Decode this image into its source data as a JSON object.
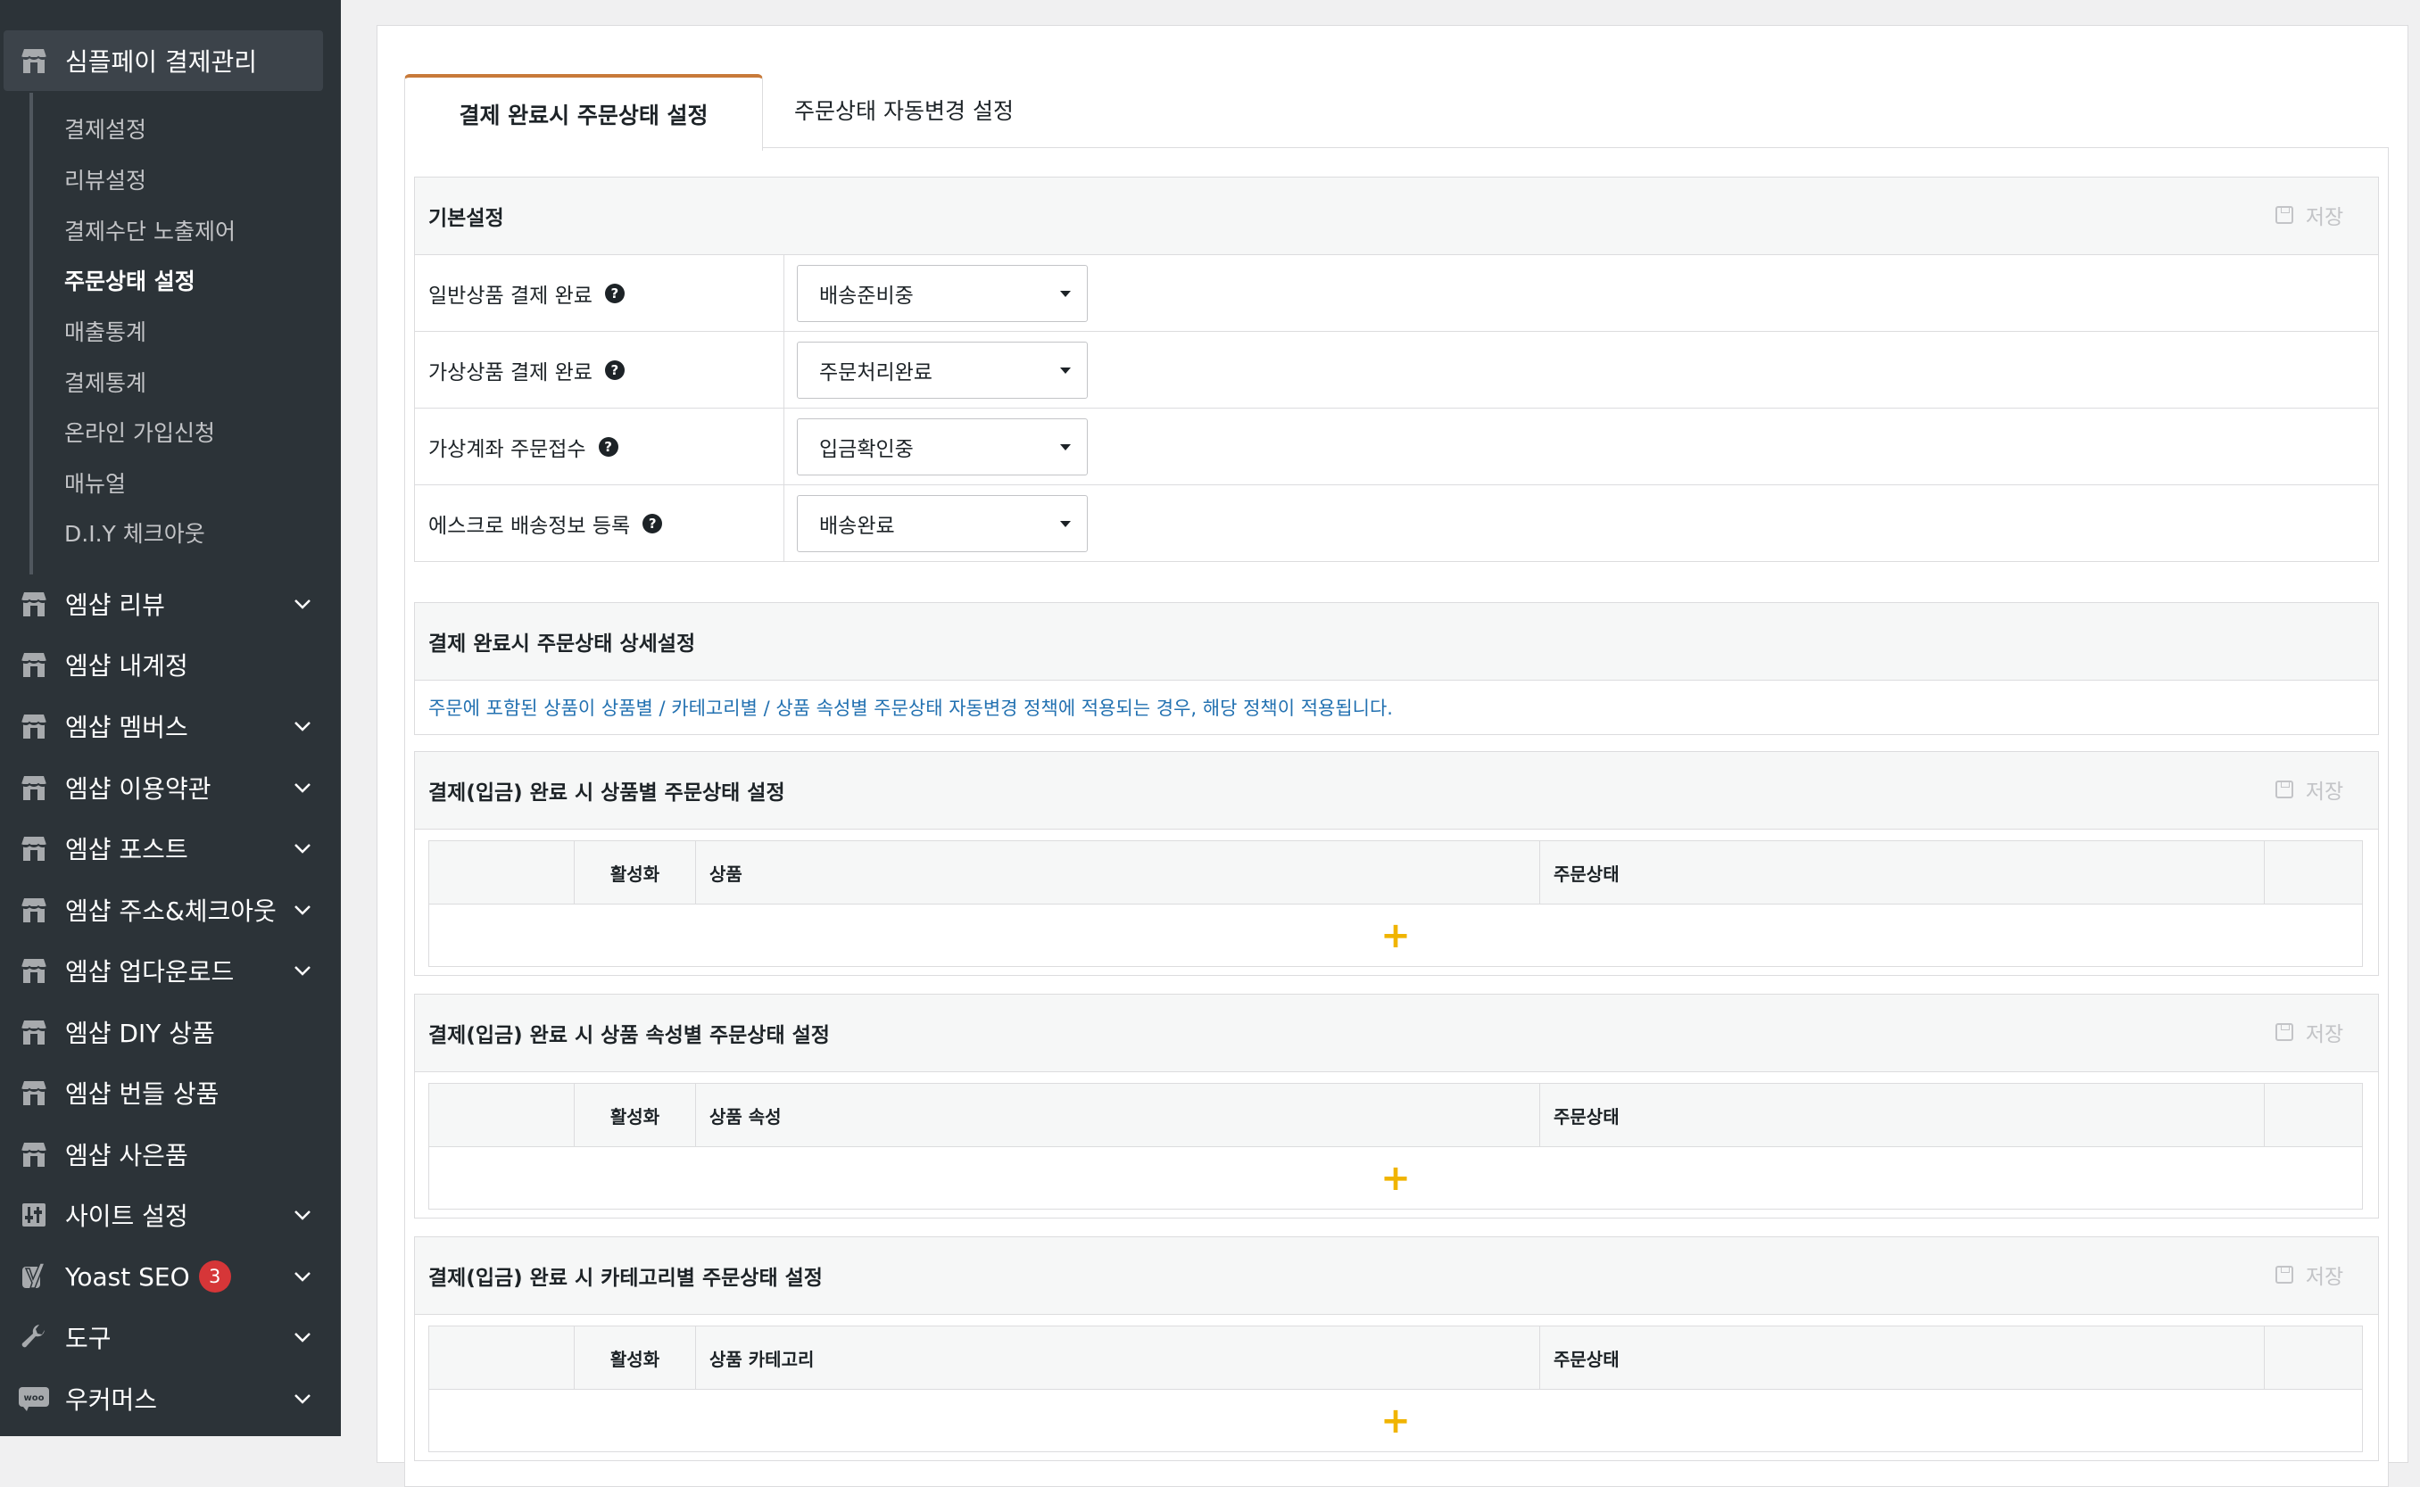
{
  "sidebar": {
    "top_menu": {
      "label": "심플페이 결제관리",
      "icon": "store-icon"
    },
    "submenu": [
      {
        "label": "결제설정"
      },
      {
        "label": "리뷰설정"
      },
      {
        "label": "결제수단 노출제어"
      },
      {
        "label": "주문상태 설정",
        "current": true
      },
      {
        "label": "매출통계"
      },
      {
        "label": "결제통계"
      },
      {
        "label": "온라인 가입신청"
      },
      {
        "label": "매뉴얼"
      },
      {
        "label": "D.I.Y 체크아웃"
      }
    ],
    "menus": [
      {
        "label": "엠샵 리뷰",
        "icon": "store-icon",
        "has_submenu": true
      },
      {
        "label": "엠샵 내계정",
        "icon": "store-icon",
        "has_submenu": false
      },
      {
        "label": "엠샵 멤버스",
        "icon": "store-icon",
        "has_submenu": true
      },
      {
        "label": "엠샵 이용약관",
        "icon": "store-icon",
        "has_submenu": true
      },
      {
        "label": "엠샵 포스트",
        "icon": "store-icon",
        "has_submenu": true
      },
      {
        "label": "엠샵 주소&체크아웃",
        "icon": "store-icon",
        "has_submenu": true
      },
      {
        "label": "엠샵 업다운로드",
        "icon": "store-icon",
        "has_submenu": true
      },
      {
        "label": "엠샵 DIY 상품",
        "icon": "store-icon",
        "has_submenu": false
      },
      {
        "label": "엠샵 번들 상품",
        "icon": "store-icon",
        "has_submenu": false
      },
      {
        "label": "엠샵 사은품",
        "icon": "store-icon",
        "has_submenu": false
      },
      {
        "label": "사이트 설정",
        "icon": "sliders-icon",
        "has_submenu": true
      },
      {
        "label": "Yoast SEO",
        "icon": "yoast-icon",
        "has_submenu": true,
        "badge": "3"
      },
      {
        "label": "도구",
        "icon": "wrench-icon",
        "has_submenu": true
      },
      {
        "label": "우커머스",
        "icon": "woo-icon",
        "has_submenu": true
      }
    ]
  },
  "tabs": [
    {
      "label": "결제 완료시 주문상태 설정",
      "active": true
    },
    {
      "label": "주문상태 자동변경 설정",
      "active": false
    }
  ],
  "basic": {
    "title": "기본설정",
    "save_label": "저장",
    "rows": [
      {
        "label": "일반상품 결제 완료",
        "value": "배송준비중"
      },
      {
        "label": "가상상품 결제 완료",
        "value": "주문처리완료"
      },
      {
        "label": "가상계좌 주문접수",
        "value": "입금확인중"
      },
      {
        "label": "에스크로 배송정보 등록",
        "value": "배송완료"
      }
    ]
  },
  "detail": {
    "title": "결제 완료시 주문상태 상세설정",
    "notice": "주문에 포함된 상품이 상품별 / 카테고리별 / 상품 속성별 주문상태 자동변경 정책에 적용되는 경우, 해당 정책이 적용됩니다."
  },
  "sections": [
    {
      "title": "결제(입금) 완료 시 상품별 주문상태 설정",
      "save_label": "저장",
      "columns": [
        "",
        "활성화",
        "상품",
        "주문상태",
        ""
      ]
    },
    {
      "title": "결제(입금) 완료 시 상품 속성별 주문상태 설정",
      "save_label": "저장",
      "columns": [
        "",
        "활성화",
        "상품 속성",
        "주문상태",
        ""
      ]
    },
    {
      "title": "결제(입금) 완료 시 카테고리별 주문상태 설정",
      "save_label": "저장",
      "columns": [
        "",
        "활성화",
        "상품 카테고리",
        "주문상태",
        ""
      ]
    }
  ],
  "colors": {
    "sidebar_bg": "#2c3338",
    "tab_accent": "#c87a3a",
    "notice_text": "#2271b1",
    "add_icon": "#f0b400",
    "badge": "#d63638"
  }
}
